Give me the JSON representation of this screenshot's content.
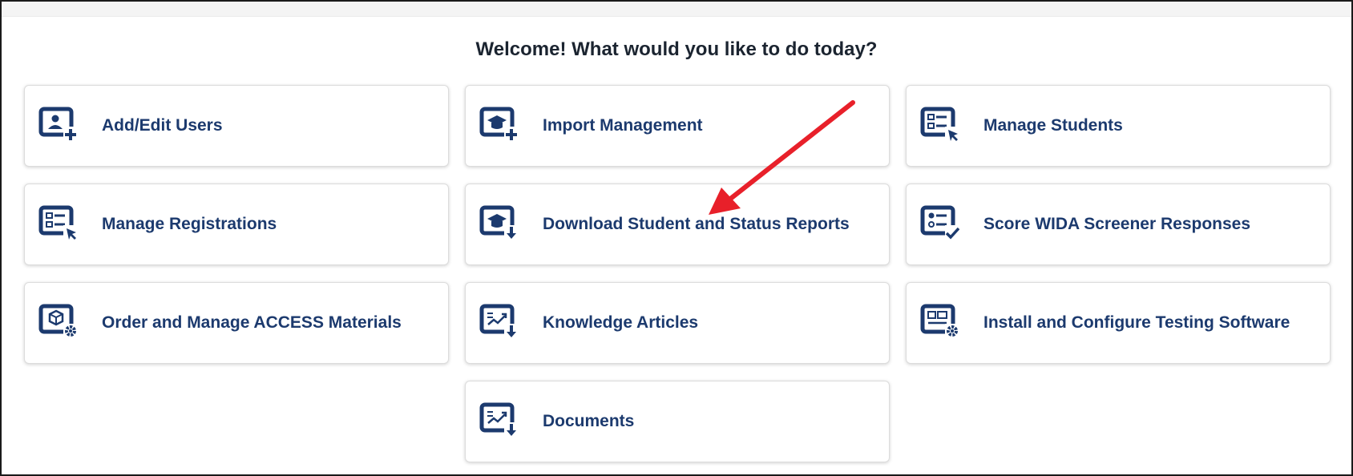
{
  "page": {
    "title": "Welcome! What would you like to do today?"
  },
  "tiles": [
    {
      "label": "Add/Edit Users",
      "icon": "user-add-icon"
    },
    {
      "label": "Import Management",
      "icon": "graduation-cap-add-icon"
    },
    {
      "label": "Manage Students",
      "icon": "list-cursor-icon"
    },
    {
      "label": "Manage Registrations",
      "icon": "list-cursor-icon"
    },
    {
      "label": "Download Student and Status Reports",
      "icon": "graduation-cap-download-icon"
    },
    {
      "label": "Score WIDA Screener Responses",
      "icon": "checklist-check-icon"
    },
    {
      "label": "Order and Manage ACCESS Materials",
      "icon": "box-gear-icon"
    },
    {
      "label": "Knowledge Articles",
      "icon": "chart-download-icon"
    },
    {
      "label": "Install and Configure Testing Software",
      "icon": "layout-gear-icon"
    },
    {
      "label": "Documents",
      "icon": "chart-download-icon"
    }
  ],
  "colors": {
    "icon": "#1c3a6e",
    "label": "#1c3a6e",
    "title": "#1b2430",
    "annotation_arrow": "#e8202a"
  }
}
